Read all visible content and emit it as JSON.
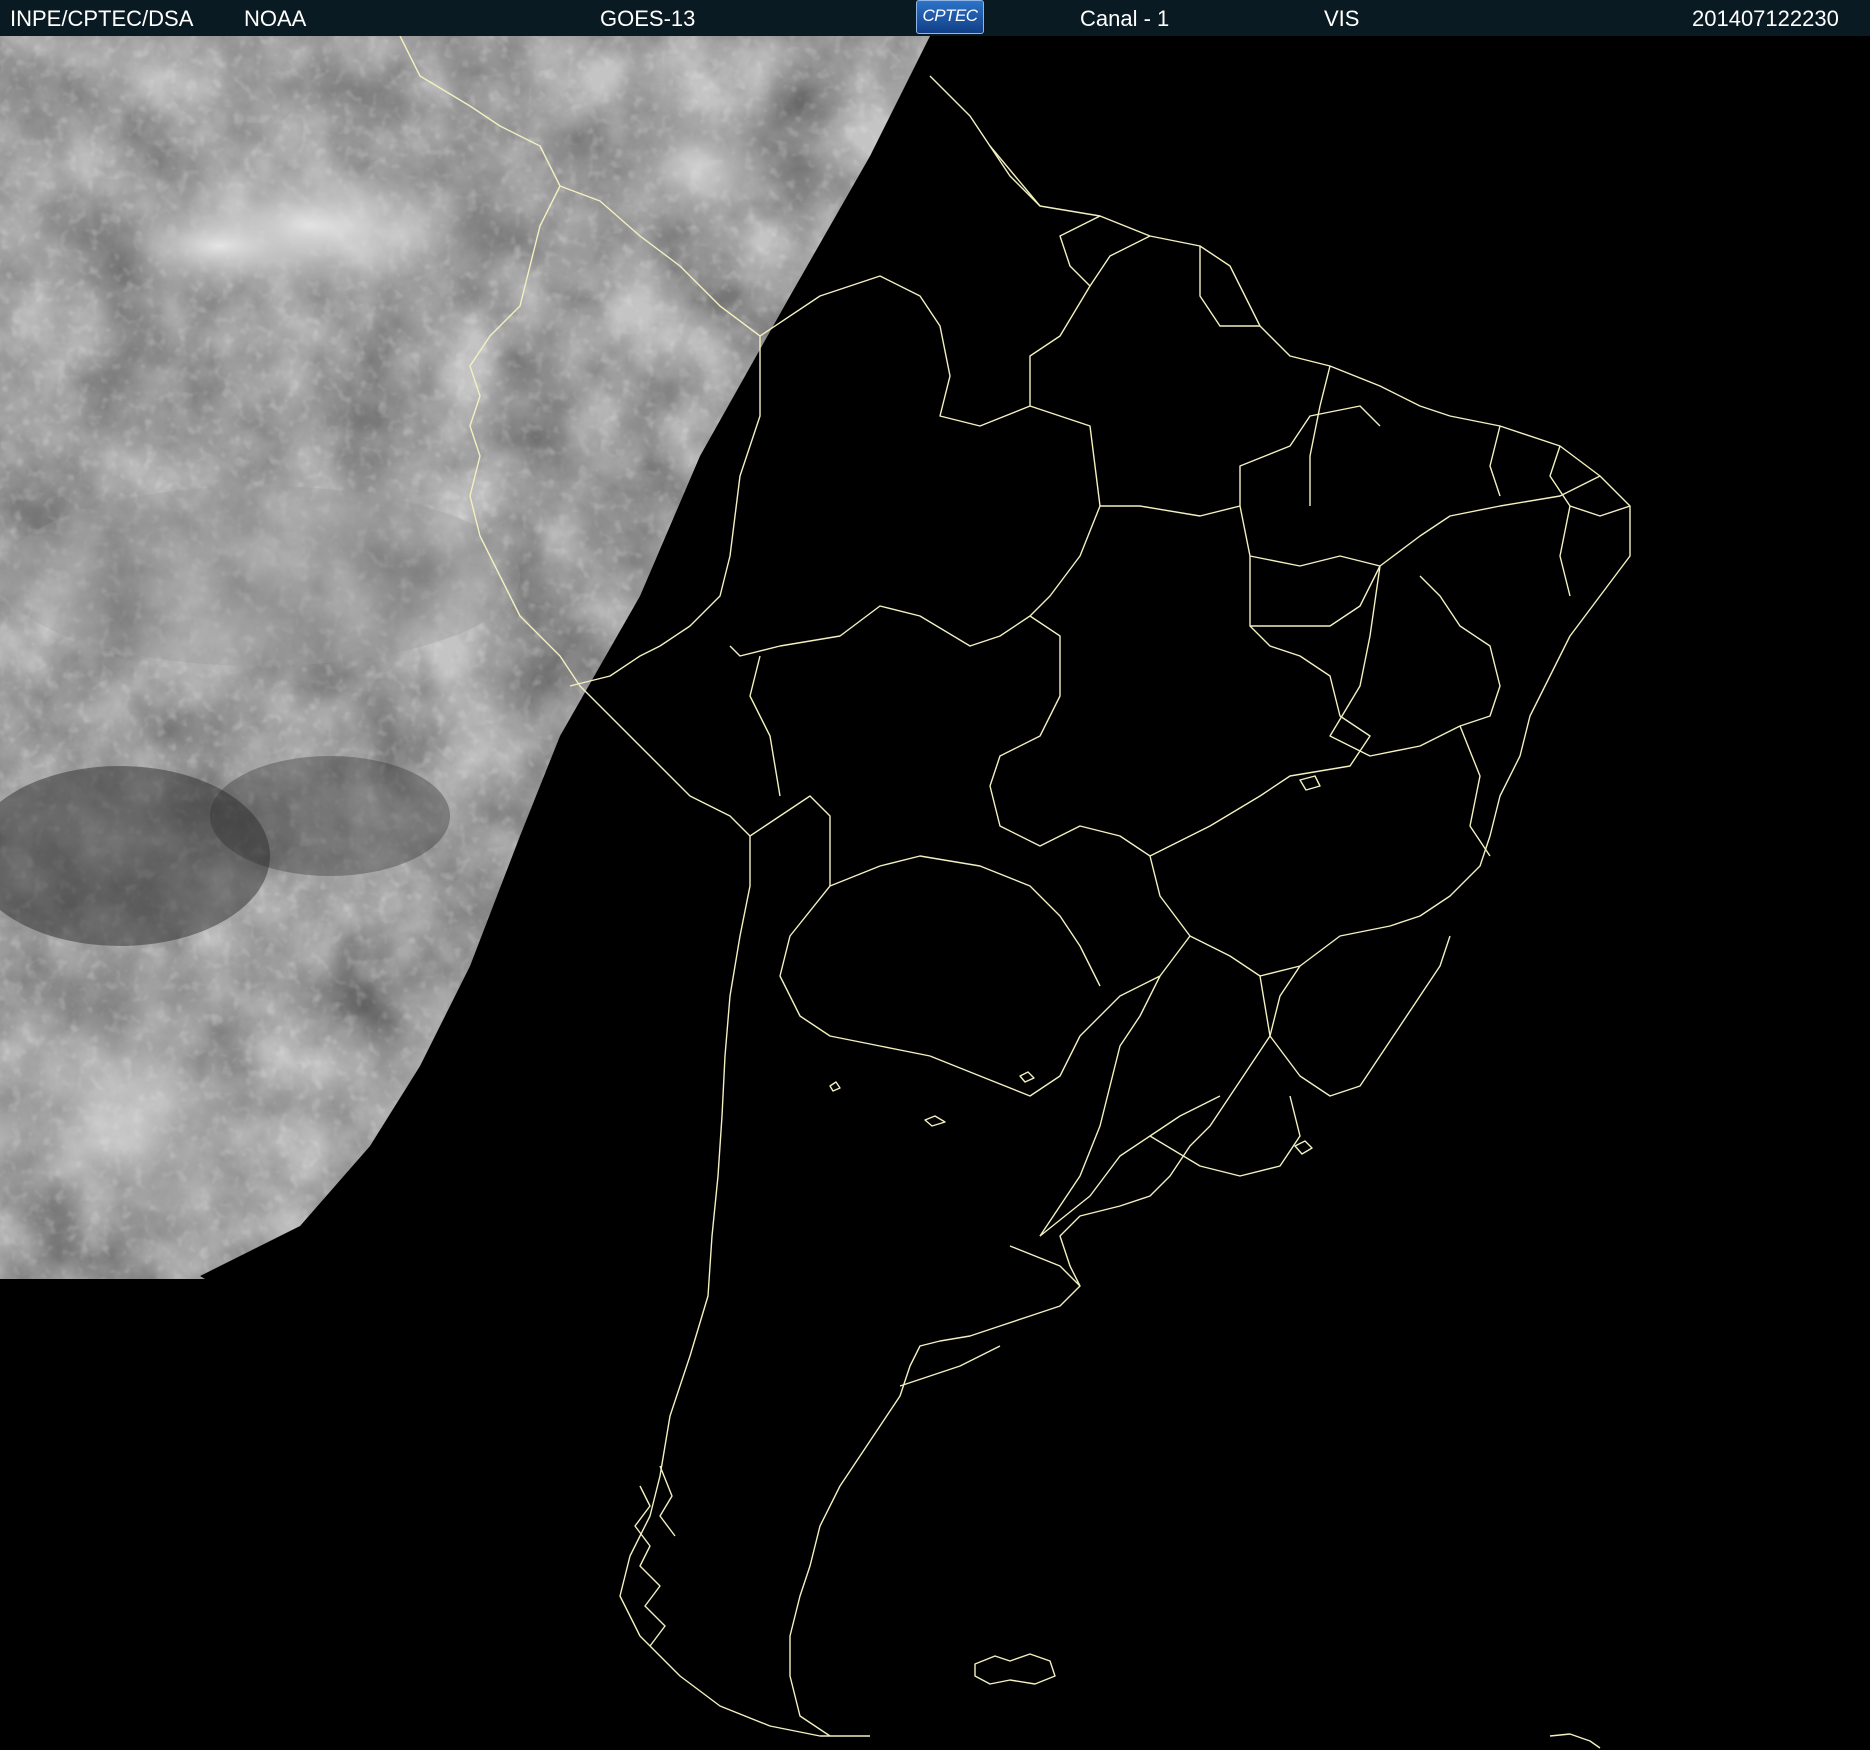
{
  "header": {
    "agency": "INPE/CPTEC/DSA",
    "provider": "NOAA",
    "satellite": "GOES-13",
    "logo_text": "CPTEC",
    "channel": "Canal - 1",
    "band": "VIS",
    "timestamp": "201407122230"
  },
  "colors": {
    "header_bg": "#0a1a22",
    "border_line": "#f2f0c0",
    "night": "#000000"
  },
  "icons": {
    "logo": "cptec-logo"
  }
}
